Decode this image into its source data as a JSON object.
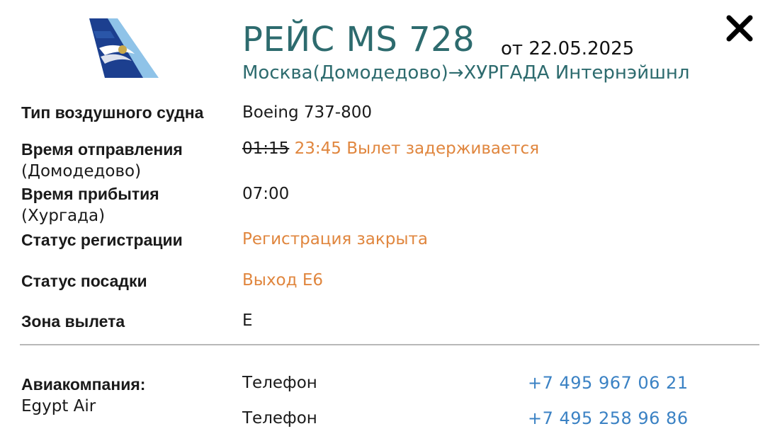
{
  "flight": {
    "title": "РЕЙС MS 728",
    "date": "от 22.05.2025",
    "route": "Москва(Домодедово)→ХУРГАДА Интернэйшнл"
  },
  "details": {
    "aircraft_label": "Тип воздушного судна",
    "aircraft_value": "Boeing 737-800",
    "departure_label": "Время отправления",
    "departure_sub": "(Домодедово)",
    "departure_old_time": "01:15",
    "departure_new_time": "23:45",
    "departure_status": "Вылет задерживается",
    "arrival_label": "Время прибытия",
    "arrival_sub": "(Хургада)",
    "arrival_time": "07:00",
    "checkin_label": "Статус регистрации",
    "checkin_value": "Регистрация закрыта",
    "boarding_label": "Статус посадки",
    "boarding_value": "Выход E6",
    "zone_label": "Зона вылета",
    "zone_value": "E"
  },
  "airline": {
    "label": "Авиакомпания:",
    "name": "Egypt Air",
    "phones": [
      {
        "label": "Телефон",
        "number": "+7 495 967 06 21"
      },
      {
        "label": "Телефон",
        "number": "+7 495 258 96 86"
      }
    ]
  },
  "colors": {
    "title": "#2d6b6e",
    "accent_orange": "#e0863e",
    "link_blue": "#3b82c4",
    "logo_dark_blue": "#1c3f8f",
    "logo_light_blue": "#8fc3e8"
  },
  "icons": {
    "logo": "egyptair-tail-logo",
    "close": "close-icon"
  }
}
